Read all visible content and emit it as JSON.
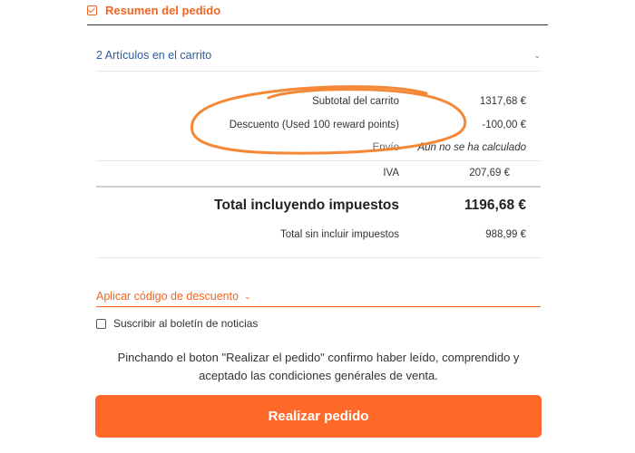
{
  "summary": {
    "title": "Resumen del pedido",
    "items_toggle": "2 Artículos en el carrito"
  },
  "totals": {
    "subtotal_label": "Subtotal del carrito",
    "subtotal_value": "1317,68 €",
    "discount_label": "Descuento (Used 100 reward points)",
    "discount_value": "-100,00 €",
    "shipping_label": "Envío",
    "shipping_value": "Aún no se ha calculado",
    "tax_label": "IVA",
    "tax_value": "207,69 €",
    "total_label": "Total incluyendo impuestos",
    "total_value": "1196,68 €",
    "total_excl_label": "Total sin incluir impuestos",
    "total_excl_value": "988,99 €"
  },
  "discount_code": {
    "label": "Aplicar código de descuento"
  },
  "newsletter": {
    "label": "Suscribir al boletín de noticias",
    "checked": false
  },
  "terms_text": "Pinchando el boton \"Realizar el pedido\" confirmo haber leído, comprendido y aceptado las condiciones genérales de venta.",
  "submit_label": "Realizar pedido",
  "colors": {
    "accent": "#f26522",
    "button": "#ff6a2b",
    "link": "#2a5b9b"
  }
}
